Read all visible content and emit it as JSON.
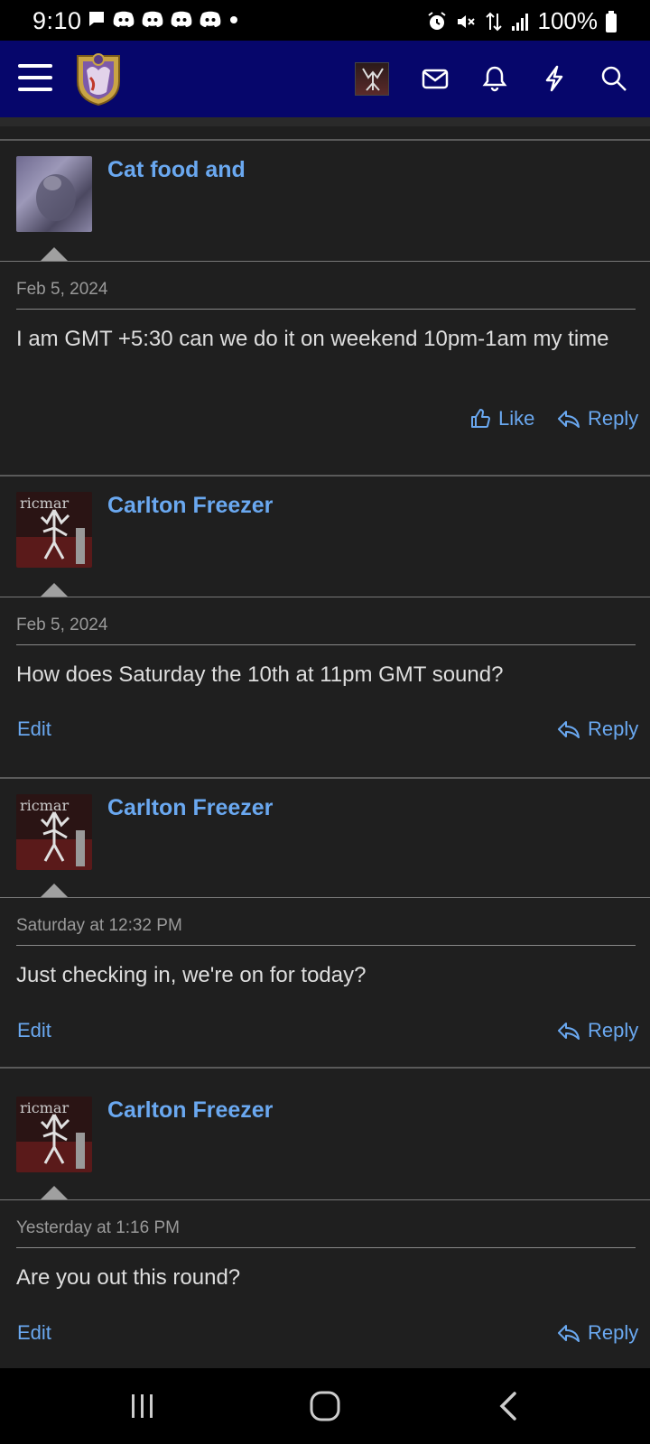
{
  "status_bar": {
    "time": "9:10",
    "battery": "100%",
    "icons": [
      "chat-icon",
      "discord-icon",
      "discord-icon",
      "discord-icon",
      "discord-icon",
      "dot-icon",
      "alarm-icon",
      "mute-icon",
      "data-icon",
      "signal-icon",
      "battery-icon"
    ]
  },
  "header": {
    "icons": [
      "menu-icon",
      "site-logo",
      "user-avatar",
      "mail-icon",
      "bell-icon",
      "bolt-icon",
      "search-icon"
    ],
    "colors": {
      "background": "#06066b",
      "accent": "#6aa8f0"
    }
  },
  "posts": [
    {
      "username": "Cat food and",
      "date": "Feb 5, 2024",
      "body": "I am GMT +5:30 can we do it on weekend 10pm-1am my time",
      "actions": {
        "like": "Like",
        "reply": "Reply"
      }
    },
    {
      "username": "Carlton Freezer",
      "date": "Feb 5, 2024",
      "body": "How does Saturday the 10th at 11pm GMT sound?",
      "actions": {
        "edit": "Edit",
        "reply": "Reply"
      }
    },
    {
      "username": "Carlton Freezer",
      "date": "Saturday at 12:32 PM",
      "body": "Just checking in, we're on for today?",
      "actions": {
        "edit": "Edit",
        "reply": "Reply"
      }
    },
    {
      "username": "Carlton Freezer",
      "date": "Yesterday at 1:16 PM",
      "body": "Are you out this round?",
      "actions": {
        "edit": "Edit",
        "reply": "Reply"
      }
    }
  ],
  "nav_bar": {
    "icons": [
      "recents-icon",
      "home-icon",
      "back-icon"
    ]
  }
}
